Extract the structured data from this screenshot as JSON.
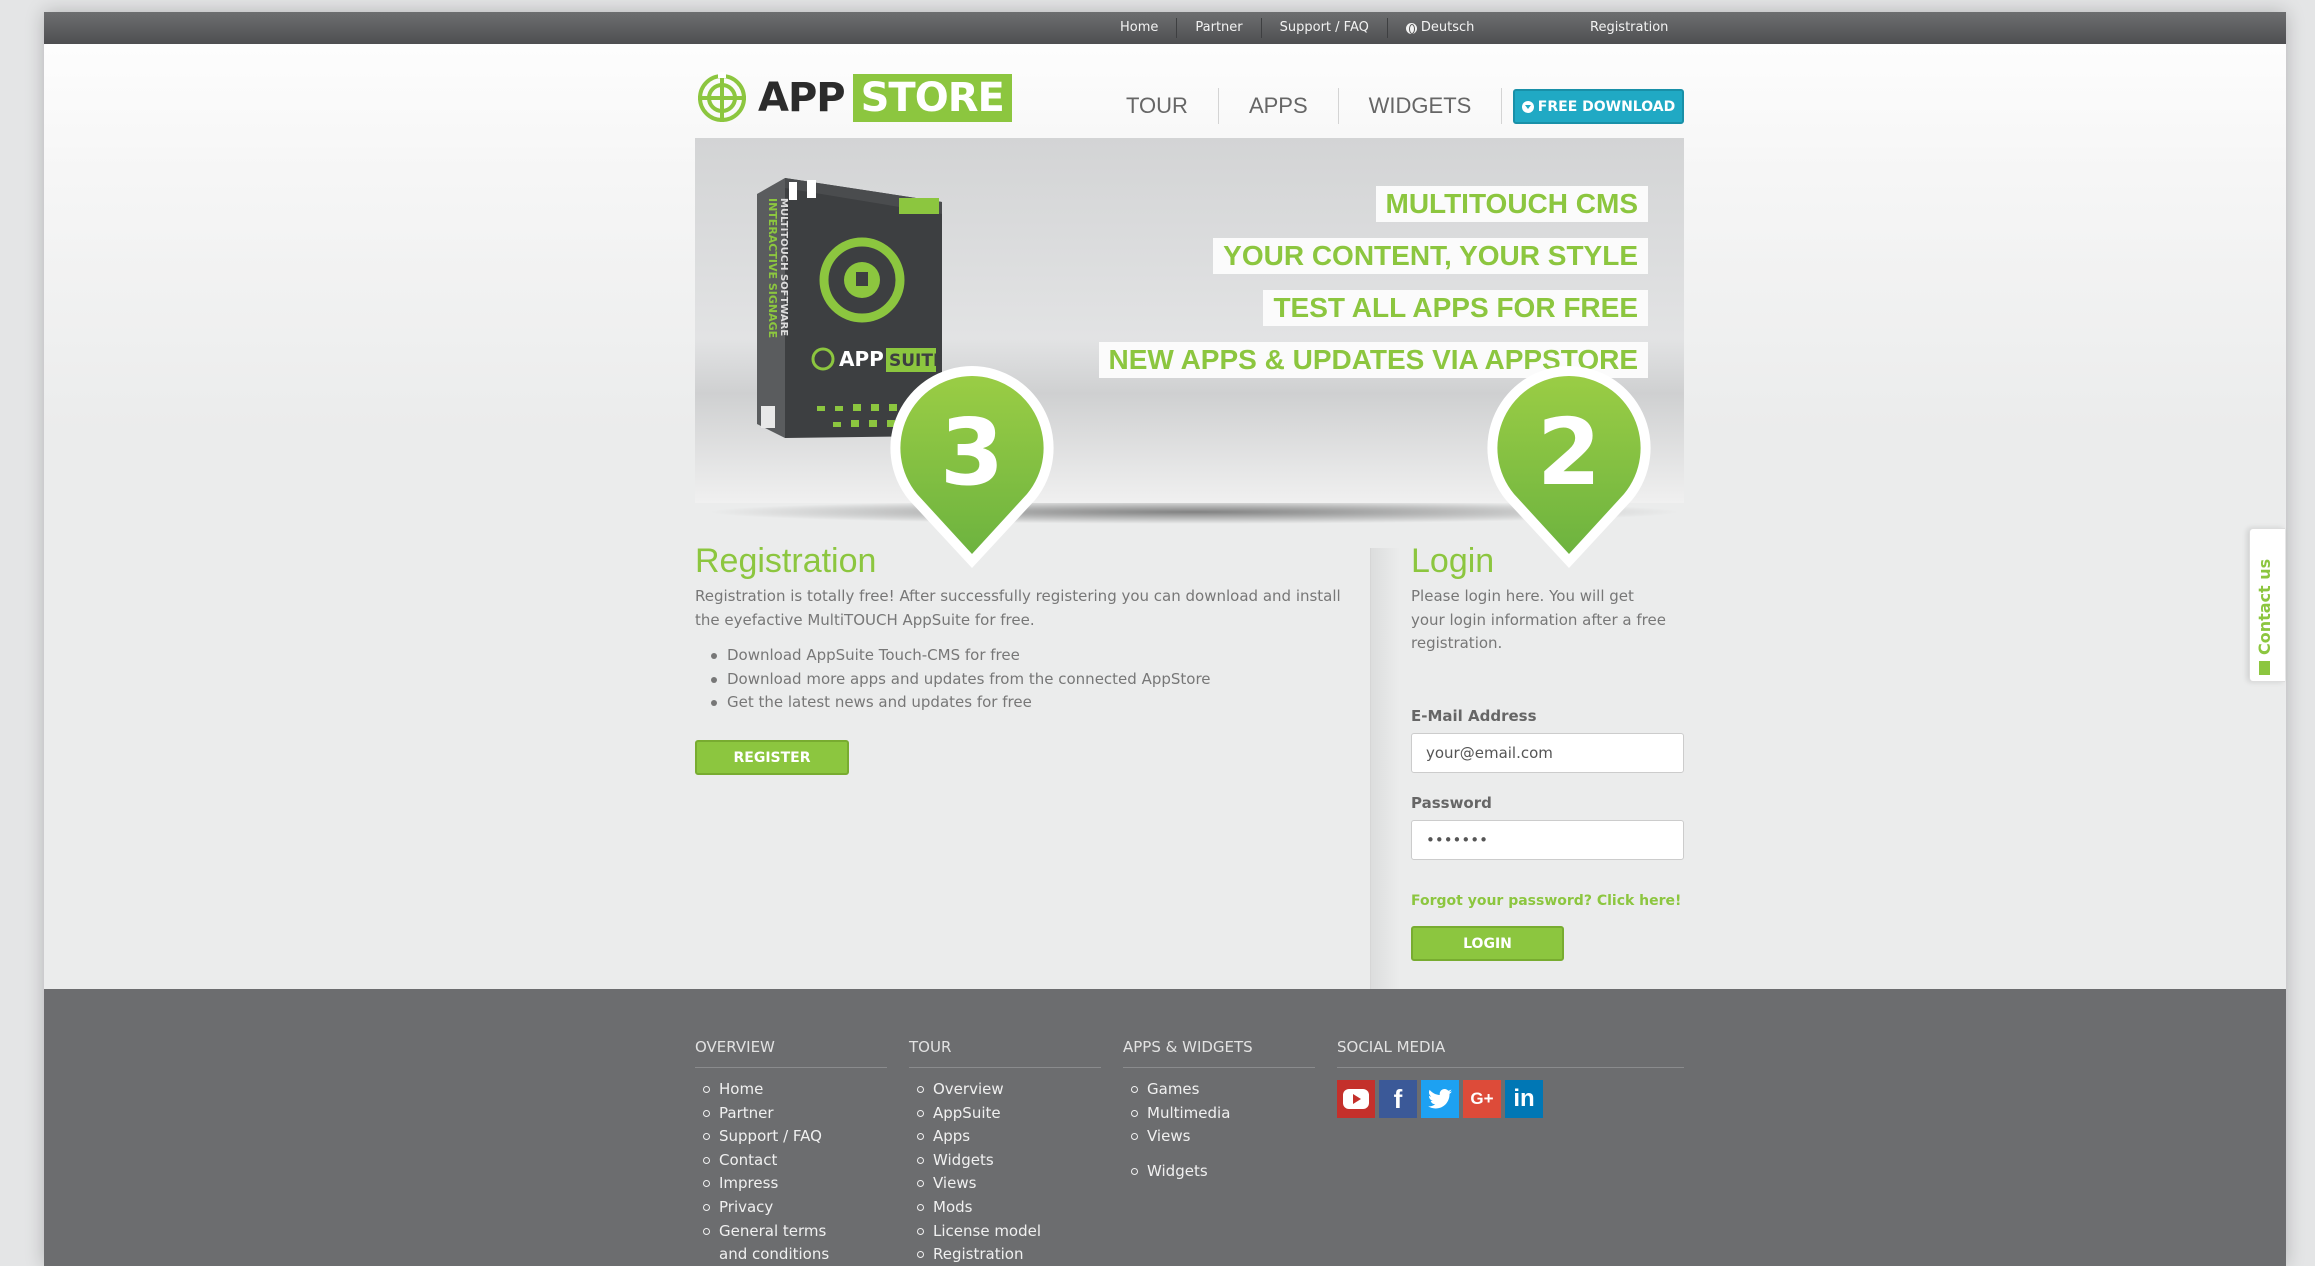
{
  "topbar": {
    "links": [
      "Home",
      "Partner",
      "Support / FAQ",
      "Deutsch"
    ],
    "registration": "Registration"
  },
  "header": {
    "logo_app": "APP",
    "logo_store": "STORE",
    "nav": [
      "TOUR",
      "APPS",
      "WIDGETS"
    ],
    "free_download": "FREE DOWNLOAD"
  },
  "hero": {
    "banners": [
      "MULTITOUCH CMS",
      "YOUR CONTENT, YOUR STYLE",
      "TEST ALL APPS FOR FREE",
      "NEW APPS & UPDATES VIA APPSTORE"
    ],
    "box_side_text": "INTERACTIVE SIGNAGE",
    "box_side_text2": "MULTITOUCH SOFTWARE",
    "box_logo_app": "APP",
    "box_logo_suite": "SUITE",
    "pin_left": "3",
    "pin_right": "2"
  },
  "registration": {
    "title": "Registration",
    "text": "Registration is totally free! After successfully registering you can download and install the eyefactive MultiTOUCH AppSuite for free.",
    "items": [
      "Download AppSuite Touch-CMS for free",
      "Download more apps and updates from the connected AppStore",
      "Get the latest news and updates for free"
    ],
    "button": "REGISTER"
  },
  "login": {
    "title": "Login",
    "text": "Please login here. You will get your login information after a free registration.",
    "email_label": "E-Mail Address",
    "email_value": "your@email.com",
    "password_label": "Password",
    "password_value": "•••••••",
    "forgot": "Forgot your password? Click here!",
    "button": "LOGIN"
  },
  "contact_tab": "Contact us",
  "footer": {
    "overview": {
      "title": "OVERVIEW",
      "items": [
        "Home",
        "Partner",
        "Support / FAQ",
        "Contact",
        "Impress",
        "Privacy",
        "General terms and conditions"
      ]
    },
    "tour": {
      "title": "TOUR",
      "items": [
        "Overview",
        "AppSuite",
        "Apps",
        "Widgets",
        "Views",
        "Mods",
        "License model",
        "Registration"
      ]
    },
    "apps_widgets": {
      "title": "APPS & WIDGETS",
      "items": [
        "Games",
        "Multimedia",
        "Views",
        "Widgets"
      ]
    },
    "social": {
      "title": "SOCIAL MEDIA",
      "icons": [
        "youtube-icon",
        "facebook-icon",
        "twitter-icon",
        "google-plus-icon",
        "linkedin-icon"
      ]
    }
  },
  "colors": {
    "accent": "#8cc63f",
    "download": "#20a9c4",
    "footer": "#6c6d6f"
  }
}
